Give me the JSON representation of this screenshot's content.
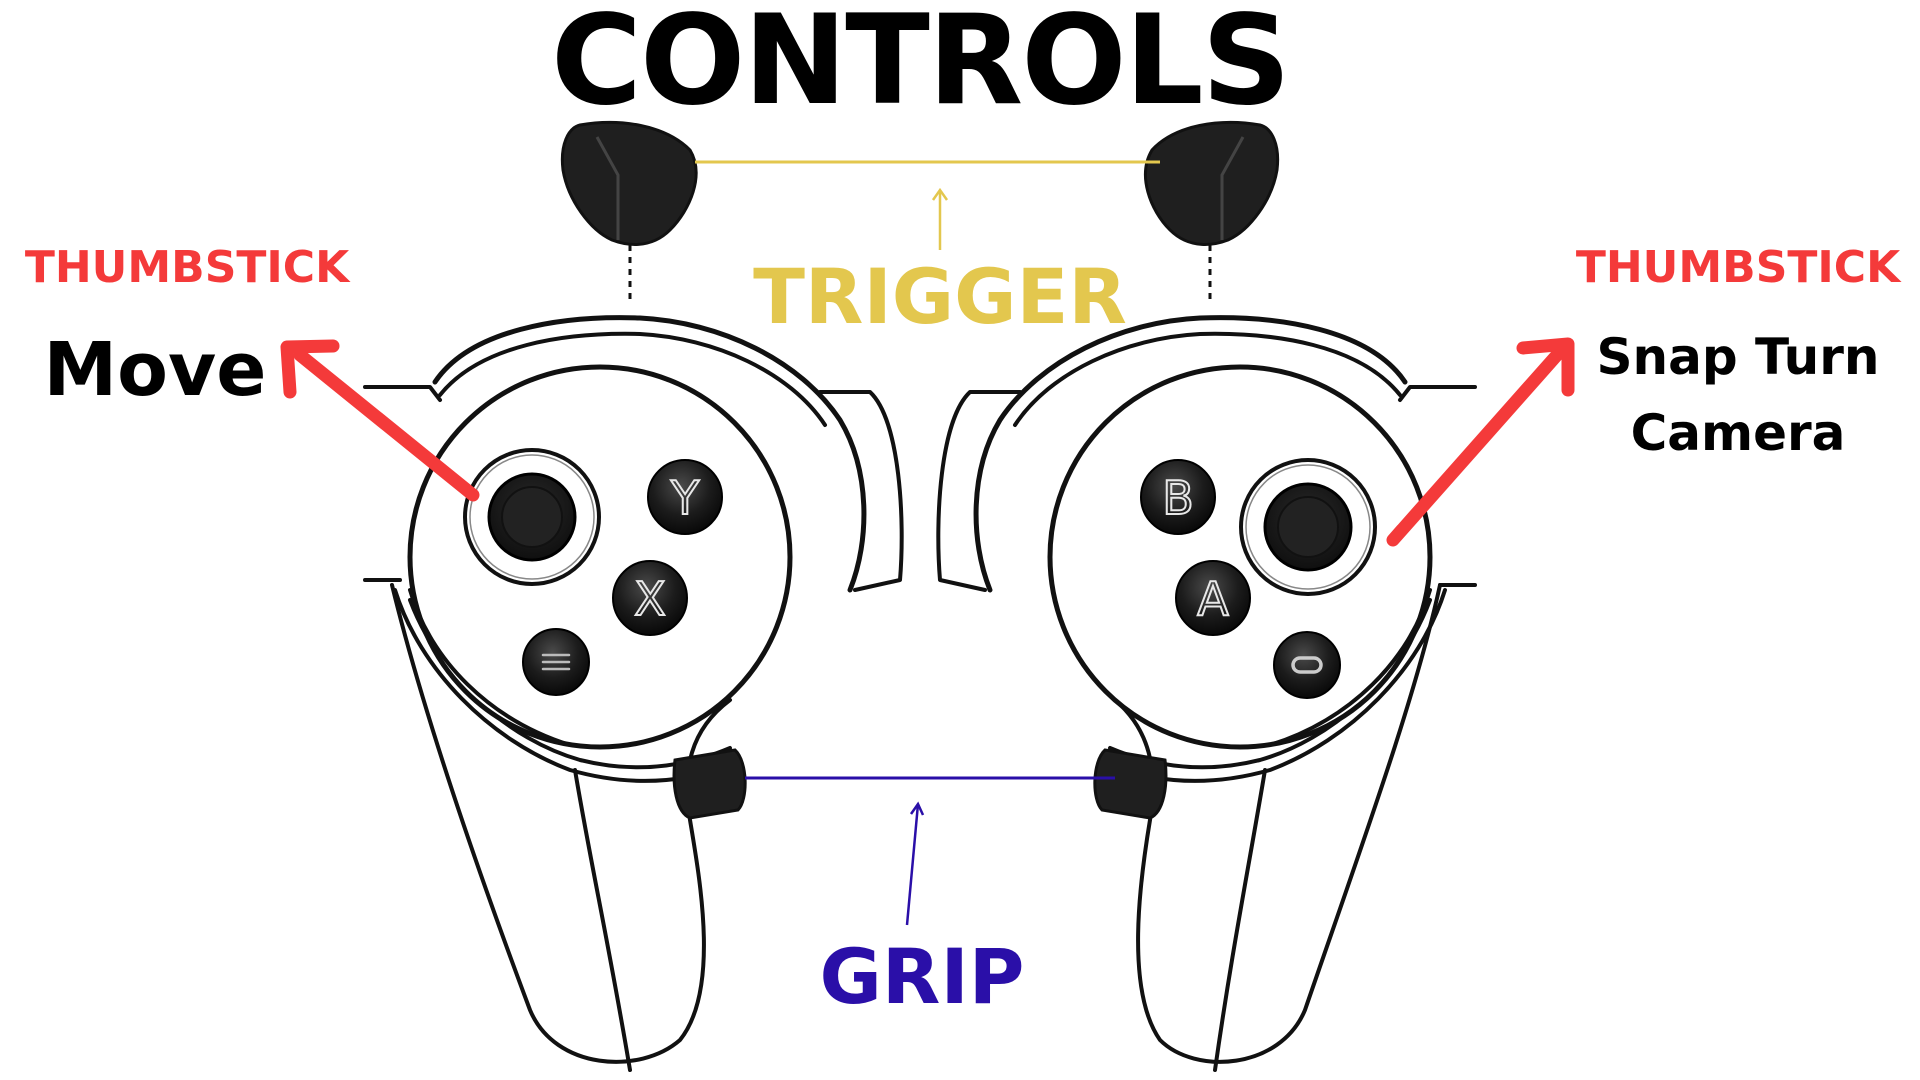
{
  "title": "CONTROLS",
  "labels": {
    "trigger": "TRIGGER",
    "grip": "GRIP",
    "left_thumbstick": "THUMBSTICK",
    "left_action": "Move",
    "right_thumbstick": "THUMBSTICK",
    "right_action_line1": "Snap Turn",
    "right_action_line2": "Camera"
  },
  "buttons": {
    "left_top": "Y",
    "left_bottom": "X",
    "right_top": "B",
    "right_bottom": "A"
  },
  "icons": {
    "left_menu": "menu-icon",
    "right_home": "oculus-home-icon"
  },
  "colors": {
    "title": "#000000",
    "trigger": "#e3c74e",
    "grip": "#2a0fa8",
    "thumbstick": "#f43a3a",
    "arrow": "#f43a3a",
    "controller_outline": "#111111",
    "button_fill": "#1a1a1a"
  }
}
